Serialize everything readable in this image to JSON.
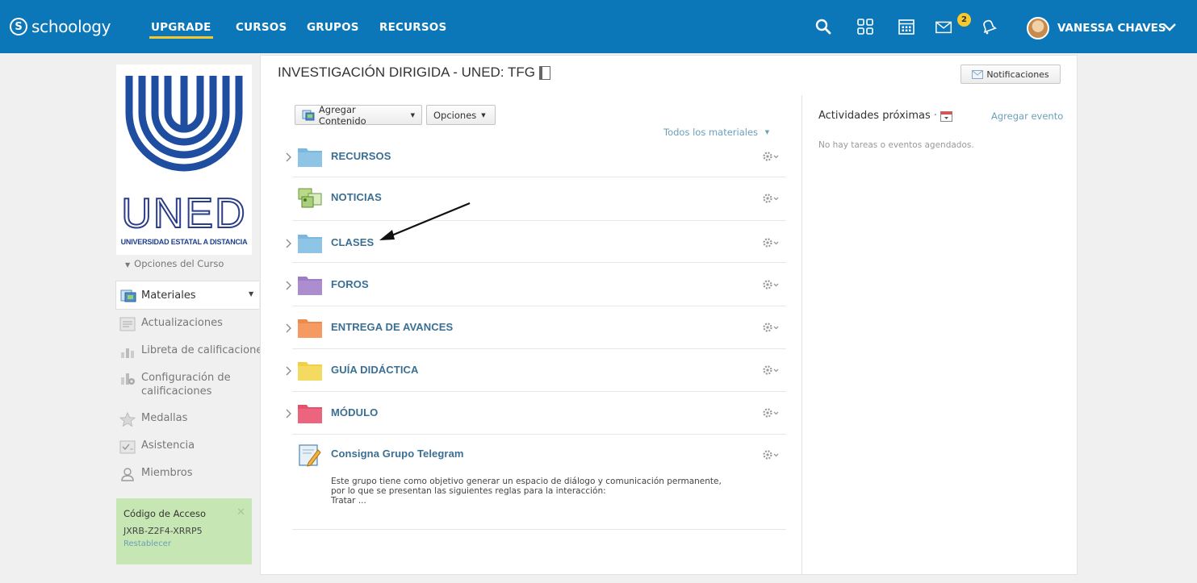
{
  "topnav": {
    "brand": "schoology",
    "links": {
      "upgrade": "UPGRADE",
      "cursos": "CURSOS",
      "grupos": "GRUPOS",
      "recursos": "RECURSOS"
    },
    "mail_badge": "2",
    "user_name": "VANESSA CHAVES",
    "icons": [
      "search-icon",
      "apps-grid-icon",
      "calendar-icon",
      "mail-icon",
      "bell-icon",
      "chevron-down-icon"
    ],
    "colors": {
      "bar": "#0c77b8",
      "accent": "#f7c92d"
    }
  },
  "sidebar": {
    "course_logo_text": "UNED",
    "course_logo_caption": "UNIVERSIDAD ESTATAL A DISTANCIA",
    "course_options": "Opciones del Curso",
    "items": [
      {
        "label": "Materiales",
        "icon": "materials-icon",
        "active": true
      },
      {
        "label": "Actualizaciones",
        "icon": "updates-icon"
      },
      {
        "label": "Libreta de calificaciones",
        "icon": "gradebook-icon"
      },
      {
        "label": "Configuración de calificaciones",
        "icon": "grade-settings-icon"
      },
      {
        "label": "Medallas",
        "icon": "badge-star-icon"
      },
      {
        "label": "Asistencia",
        "icon": "attendance-icon"
      },
      {
        "label": "Miembros",
        "icon": "members-icon"
      }
    ],
    "access_code": {
      "label": "Código de Acceso",
      "code": "JXRB-Z2F4-XRRP5",
      "reset": "Restablecer"
    }
  },
  "main": {
    "title": "INVESTIGACIÓN DIRIGIDA - UNED: TFG",
    "notifications_button": "Notificaciones",
    "add_content": "Agregar Contenido",
    "options": "Opciones",
    "filter": "Todos los materiales",
    "materials": [
      {
        "name": "RECURSOS",
        "type": "folder",
        "color": "#7ab8df"
      },
      {
        "name": "NOTICIAS",
        "type": "page"
      },
      {
        "name": "CLASES",
        "type": "folder",
        "color": "#7ab8df"
      },
      {
        "name": "FOROS",
        "type": "folder",
        "color": "#9c7cc4"
      },
      {
        "name": "ENTREGA DE AVANCES",
        "type": "folder",
        "color": "#f08a4b"
      },
      {
        "name": "GUÍA DIDÁCTICA",
        "type": "folder",
        "color": "#f2d042"
      },
      {
        "name": "MÓDULO",
        "type": "folder",
        "color": "#e5506b"
      },
      {
        "name": "Consigna Grupo Telegram",
        "type": "assignment"
      }
    ],
    "telegram_description": [
      "Este grupo tiene como objetivo generar un espacio de diálogo y comunicación permanente,",
      "por lo que se presentan las siguientes reglas para la interacción:",
      "Tratar ..."
    ]
  },
  "upcoming": {
    "title": "Actividades próximas",
    "add_event": "Agregar evento",
    "empty": "No hay tareas o eventos agendados."
  }
}
